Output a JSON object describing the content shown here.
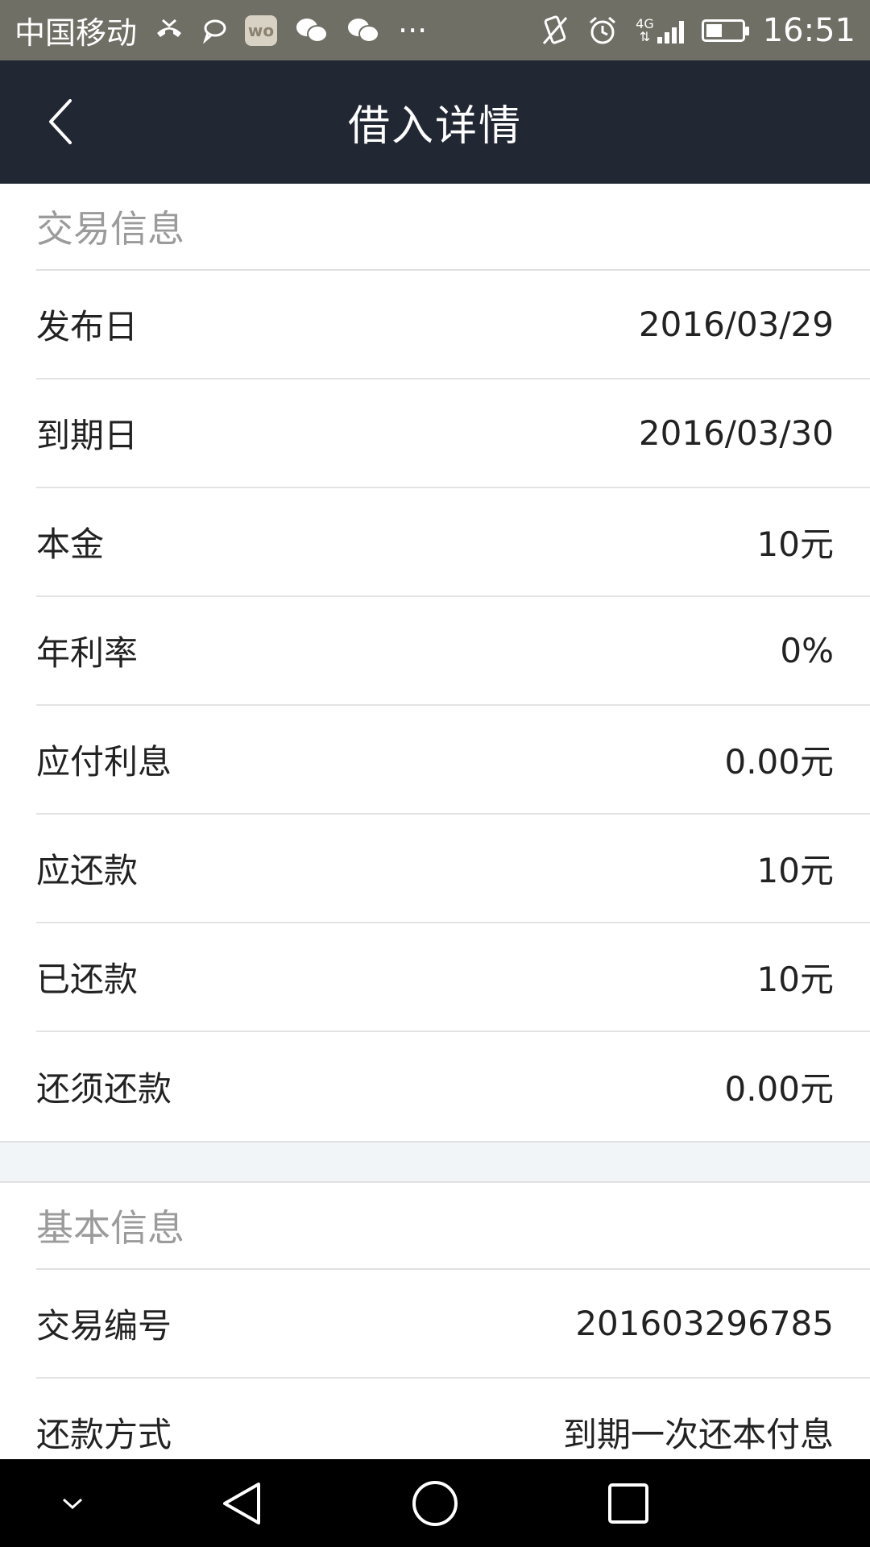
{
  "status_bar": {
    "carrier": "中国移动",
    "wo_badge": "wo",
    "more": "···",
    "network_type": "4G",
    "time": "16:51",
    "battery_level": 0.45
  },
  "header": {
    "title": "借入详情"
  },
  "sections": [
    {
      "title": "交易信息",
      "rows": [
        {
          "label": "发布日",
          "value": "2016/03/29"
        },
        {
          "label": "到期日",
          "value": "2016/03/30"
        },
        {
          "label": "本金",
          "value": "10元"
        },
        {
          "label": "年利率",
          "value": "0%"
        },
        {
          "label": "应付利息",
          "value": "0.00元"
        },
        {
          "label": "应还款",
          "value": "10元"
        },
        {
          "label": "已还款",
          "value": "10元"
        },
        {
          "label": "还须还款",
          "value": "0.00元"
        }
      ]
    },
    {
      "title": "基本信息",
      "rows": [
        {
          "label": "交易编号",
          "value": "201603296785"
        },
        {
          "label": "还款方式",
          "value": "到期一次还本付息"
        }
      ]
    }
  ],
  "colors": {
    "header_bg": "#212733",
    "status_bg": "#6f6f66",
    "section_title": "#9b9b9b",
    "divider": "#e3e3e3",
    "gap_bg": "#f2f5f7"
  },
  "icons": {
    "back": "chevron-left-icon",
    "nav_hide": "chevron-down-icon",
    "nav_back": "triangle-back-icon",
    "nav_home": "circle-home-icon",
    "nav_recents": "square-recents-icon"
  }
}
